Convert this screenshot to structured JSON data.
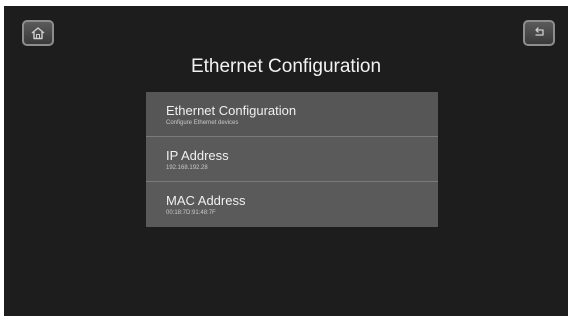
{
  "header": {
    "title": "Ethernet Configuration",
    "home_icon": "home-icon",
    "back_icon": "back-arrow-icon"
  },
  "menu": {
    "items": [
      {
        "title": "Ethernet Configuration",
        "subtitle": "Configure Ethernet devices"
      },
      {
        "title": "IP Address",
        "subtitle": "192.168.192.28"
      },
      {
        "title": "MAC Address",
        "subtitle": "00:18:7D:91:48:7F"
      }
    ]
  },
  "colors": {
    "background": "#1d1d1d",
    "menu_item": "#5a5a5a",
    "text": "#f0f0f0"
  }
}
